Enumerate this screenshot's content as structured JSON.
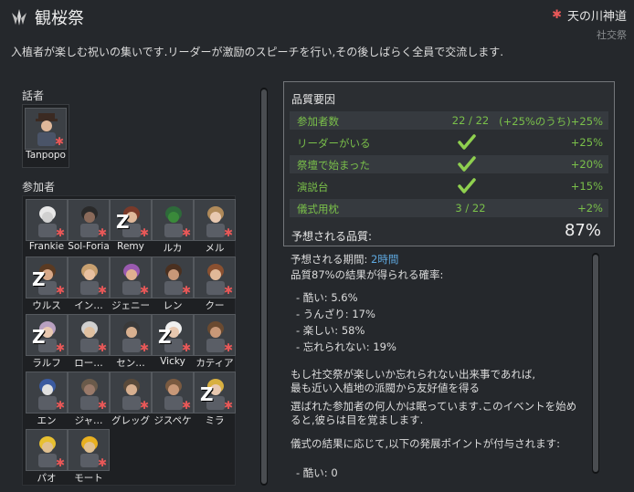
{
  "header": {
    "title": "観桜祭",
    "ideology_name": "天の川神道",
    "ritual_type": "社交祭",
    "description": "入植者が楽しむ祝いの集いです.リーダーが激励のスピーチを行い,その後しばらく全員で交流します."
  },
  "speaker": {
    "label": "話者",
    "pawn": {
      "name": "Tanpopo",
      "icon": "person-hat-icon"
    }
  },
  "participants": {
    "label": "参加者",
    "pawns": [
      {
        "name": "Frankie",
        "icon": "person-icon",
        "sleeping": false
      },
      {
        "name": "Sol-Foria",
        "icon": "person-icon",
        "sleeping": false
      },
      {
        "name": "Remy",
        "icon": "person-icon",
        "sleeping": true
      },
      {
        "name": "ルカ",
        "icon": "person-icon",
        "sleeping": false
      },
      {
        "name": "メル",
        "icon": "person-icon",
        "sleeping": false
      },
      {
        "name": "ウルス",
        "icon": "person-icon",
        "sleeping": true
      },
      {
        "name": "イン…",
        "icon": "person-icon",
        "sleeping": false
      },
      {
        "name": "ジェニー",
        "icon": "person-icon",
        "sleeping": false
      },
      {
        "name": "レン",
        "icon": "person-icon",
        "sleeping": false
      },
      {
        "name": "クー",
        "icon": "person-icon",
        "sleeping": false
      },
      {
        "name": "ラルフ",
        "icon": "person-icon",
        "sleeping": true
      },
      {
        "name": "ロー…",
        "icon": "person-icon",
        "sleeping": false
      },
      {
        "name": "セン…",
        "icon": "person-icon",
        "sleeping": false
      },
      {
        "name": "Vicky",
        "icon": "person-icon",
        "sleeping": true
      },
      {
        "name": "カティア",
        "icon": "person-icon",
        "sleeping": false
      },
      {
        "name": "エン",
        "icon": "person-icon",
        "sleeping": false
      },
      {
        "name": "ジャ…",
        "icon": "person-icon",
        "sleeping": false
      },
      {
        "name": "グレッグ",
        "icon": "person-icon",
        "sleeping": false
      },
      {
        "name": "ジスペケ",
        "icon": "person-icon",
        "sleeping": false
      },
      {
        "name": "ミラ",
        "icon": "person-icon",
        "sleeping": true
      },
      {
        "name": "パオ",
        "icon": "person-icon",
        "sleeping": false
      },
      {
        "name": "モート",
        "icon": "person-icon",
        "sleeping": false
      }
    ]
  },
  "quality": {
    "title": "品質要因",
    "rows": [
      {
        "label": "参加者数",
        "mid": "22 / 22",
        "value": "(+25%のうち)+25%",
        "check": false
      },
      {
        "label": "リーダーがいる",
        "mid": "",
        "value": "+25%",
        "check": true
      },
      {
        "label": "祭壇で始まった",
        "mid": "",
        "value": "+20%",
        "check": true
      },
      {
        "label": "演説台",
        "mid": "",
        "value": "+15%",
        "check": true
      },
      {
        "label": "儀式用枕",
        "mid": "3 / 22",
        "value": "+2%",
        "check": false
      }
    ],
    "expected_label": "予想される品質:",
    "expected_value": "87%"
  },
  "info": {
    "duration_label": "予想される期間:",
    "duration_value": "2時間",
    "chance_header": "品質87%の結果が得られる確率:",
    "outcomes": [
      "- 酷い: 5.6%",
      "- うんざり: 17%",
      "- 楽しい: 58%",
      "- 忘れられない: 19%"
    ],
    "note1a": "もし社交祭が楽しいか忘れられない出来事であれば,",
    "note1b": "最も近い入植地の派閥から友好値を得る",
    "note2a": "選ばれた参加者の何人かは眠っています.このイベントを始め",
    "note2b": "ると,彼らは目を覚まします.",
    "note3": "儀式の結果に応じて,以下の発展ポイントが付与されます:",
    "cut_line": "- 酷い: 0"
  },
  "colors": {
    "accent_green": "#7ac04a",
    "highlight_blue": "#5fa9e0",
    "ideo_red": "#e85858"
  }
}
